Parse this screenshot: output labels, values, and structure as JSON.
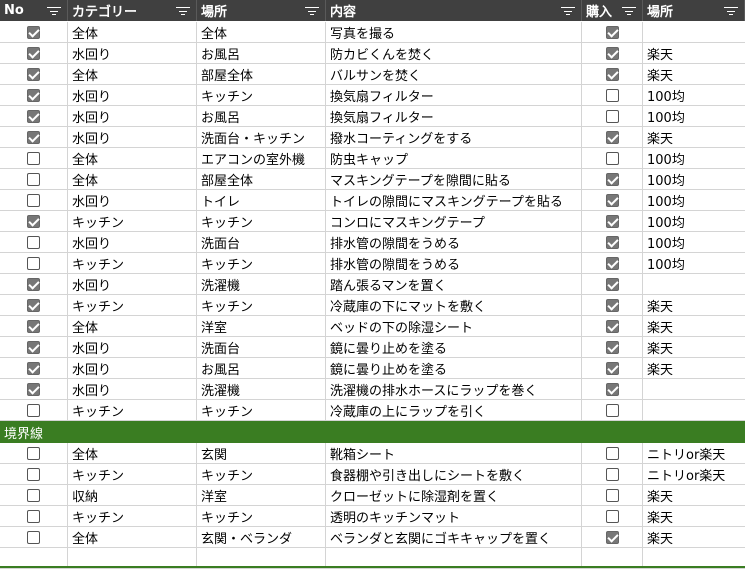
{
  "header": {
    "no": "No",
    "category": "カテゴリー",
    "place": "場所",
    "content": "内容",
    "buy": "購入",
    "store": "場所"
  },
  "rows_top": [
    {
      "no": true,
      "category": "全体",
      "place": "全体",
      "content": "写真を撮る",
      "buy": true,
      "store": ""
    },
    {
      "no": true,
      "category": "水回り",
      "place": "お風呂",
      "content": "防カビくんを焚く",
      "buy": true,
      "store": "楽天"
    },
    {
      "no": true,
      "category": "全体",
      "place": "部屋全体",
      "content": "バルサンを焚く",
      "buy": true,
      "store": "楽天"
    },
    {
      "no": true,
      "category": "水回り",
      "place": "キッチン",
      "content": "換気扇フィルター",
      "buy": false,
      "store": "100均"
    },
    {
      "no": true,
      "category": "水回り",
      "place": "お風呂",
      "content": "換気扇フィルター",
      "buy": false,
      "store": "100均"
    },
    {
      "no": true,
      "category": "水回り",
      "place": "洗面台・キッチン",
      "content": "撥水コーティングをする",
      "buy": true,
      "store": "楽天"
    },
    {
      "no": false,
      "category": "全体",
      "place": "エアコンの室外機",
      "content": "防虫キャップ",
      "buy": false,
      "store": "100均"
    },
    {
      "no": false,
      "category": "全体",
      "place": "部屋全体",
      "content": "マスキングテープを隙間に貼る",
      "buy": true,
      "store": "100均"
    },
    {
      "no": false,
      "category": "水回り",
      "place": "トイレ",
      "content": "トイレの隙間にマスキングテープを貼る",
      "buy": true,
      "store": "100均"
    },
    {
      "no": true,
      "category": "キッチン",
      "place": "キッチン",
      "content": "コンロにマスキングテープ",
      "buy": true,
      "store": "100均"
    },
    {
      "no": false,
      "category": "水回り",
      "place": "洗面台",
      "content": "排水管の隙間をうめる",
      "buy": true,
      "store": "100均"
    },
    {
      "no": false,
      "category": "キッチン",
      "place": "キッチン",
      "content": "排水管の隙間をうめる",
      "buy": true,
      "store": "100均"
    },
    {
      "no": true,
      "category": "水回り",
      "place": "洗濯機",
      "content": "踏ん張るマンを置く",
      "buy": true,
      "store": ""
    },
    {
      "no": true,
      "category": "キッチン",
      "place": "キッチン",
      "content": "冷蔵庫の下にマットを敷く",
      "buy": true,
      "store": "楽天"
    },
    {
      "no": true,
      "category": "全体",
      "place": "洋室",
      "content": "ベッドの下の除湿シート",
      "buy": true,
      "store": "楽天"
    },
    {
      "no": true,
      "category": "水回り",
      "place": "洗面台",
      "content": "鏡に曇り止めを塗る",
      "buy": true,
      "store": "楽天"
    },
    {
      "no": true,
      "category": "水回り",
      "place": "お風呂",
      "content": "鏡に曇り止めを塗る",
      "buy": true,
      "store": "楽天"
    },
    {
      "no": true,
      "category": "水回り",
      "place": "洗濯機",
      "content": "洗濯機の排水ホースにラップを巻く",
      "buy": true,
      "store": ""
    },
    {
      "no": false,
      "category": "キッチン",
      "place": "キッチン",
      "content": "冷蔵庫の上にラップを引く",
      "buy": false,
      "store": ""
    }
  ],
  "divider_label": "境界線",
  "rows_bottom": [
    {
      "no": false,
      "category": "全体",
      "place": "玄関",
      "content": "靴箱シート",
      "buy": false,
      "store": "ニトリor楽天"
    },
    {
      "no": false,
      "category": "キッチン",
      "place": "キッチン",
      "content": "食器棚や引き出しにシートを敷く",
      "buy": false,
      "store": "ニトリor楽天"
    },
    {
      "no": false,
      "category": "収納",
      "place": "洋室",
      "content": "クローゼットに除湿剤を置く",
      "buy": false,
      "store": "楽天"
    },
    {
      "no": false,
      "category": "キッチン",
      "place": "キッチン",
      "content": "透明のキッチンマット",
      "buy": false,
      "store": "楽天"
    },
    {
      "no": false,
      "category": "全体",
      "place": "玄関・ベランダ",
      "content": "ベランダと玄関にゴキキャップを置く",
      "buy": true,
      "store": "楽天"
    }
  ],
  "colors": {
    "header_bg": "#404040",
    "divider_bg": "#3a7d22",
    "checked": "#777777"
  }
}
